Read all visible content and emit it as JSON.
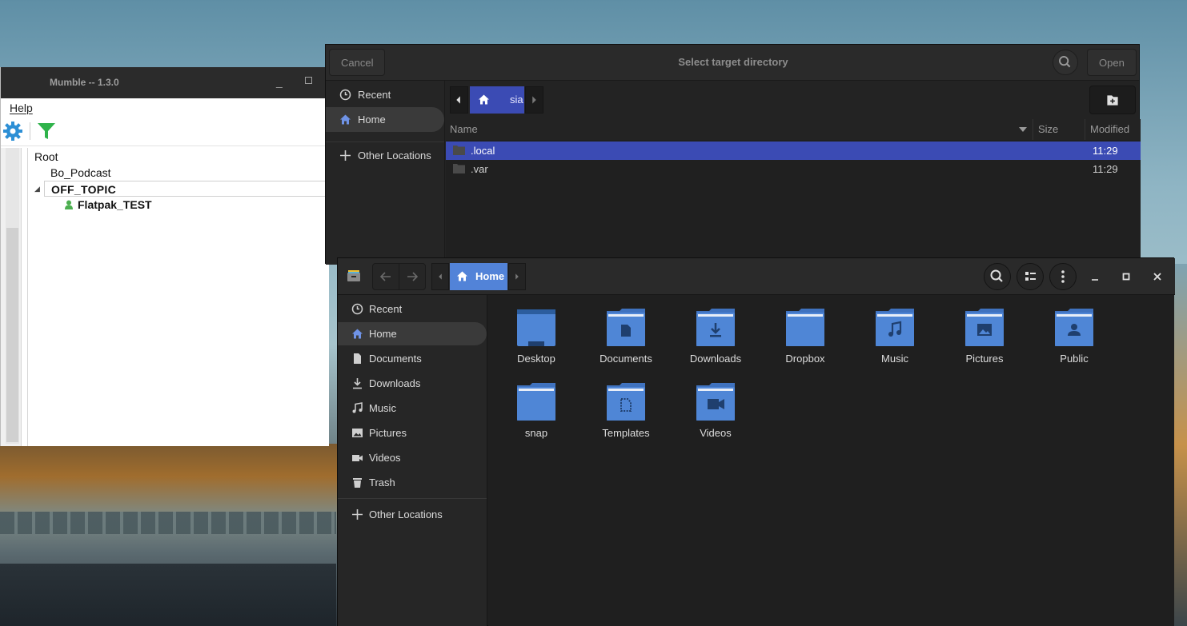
{
  "mumble": {
    "title": "Mumble -- 1.3.0",
    "menu_help": "Help",
    "tree": {
      "root": "Root",
      "channel_1": "Bo_Podcast",
      "channel_2": "OFF_TOPIC",
      "user": "Flatpak_TEST"
    }
  },
  "dialog": {
    "title": "Select target directory",
    "cancel_label": "Cancel",
    "open_label": "Open",
    "sidebar": [
      {
        "label": "Recent",
        "icon": "clock-icon"
      },
      {
        "label": "Home",
        "icon": "home-icon"
      },
      {
        "label": "Other Locations",
        "icon": "plus-icon"
      }
    ],
    "path_current": "sia",
    "columns": {
      "name": "Name",
      "size": "Size",
      "modified": "Modified"
    },
    "files": [
      {
        "name": ".local",
        "modified": "11:29"
      },
      {
        "name": ".var",
        "modified": "11:29"
      }
    ],
    "accent": "#3b4bb4"
  },
  "files": {
    "path_current": "Home",
    "sidebar": [
      {
        "label": "Recent",
        "icon": "clock-icon"
      },
      {
        "label": "Home",
        "icon": "home-icon"
      },
      {
        "label": "Documents",
        "icon": "document-icon"
      },
      {
        "label": "Downloads",
        "icon": "download-icon"
      },
      {
        "label": "Music",
        "icon": "music-icon"
      },
      {
        "label": "Pictures",
        "icon": "picture-icon"
      },
      {
        "label": "Videos",
        "icon": "video-icon"
      },
      {
        "label": "Trash",
        "icon": "trash-icon"
      },
      {
        "label": "Other Locations",
        "icon": "plus-icon"
      }
    ],
    "folders": [
      {
        "label": "Desktop",
        "icon": "desktop-folder-icon"
      },
      {
        "label": "Documents",
        "icon": "documents-folder-icon"
      },
      {
        "label": "Downloads",
        "icon": "downloads-folder-icon"
      },
      {
        "label": "Dropbox",
        "icon": "folder-icon"
      },
      {
        "label": "Music",
        "icon": "music-folder-icon"
      },
      {
        "label": "Pictures",
        "icon": "pictures-folder-icon"
      },
      {
        "label": "Public",
        "icon": "public-folder-icon"
      },
      {
        "label": "snap",
        "icon": "folder-icon"
      },
      {
        "label": "Templates",
        "icon": "templates-folder-icon"
      },
      {
        "label": "Videos",
        "icon": "videos-folder-icon"
      }
    ],
    "accent": "#5283d8",
    "folder_color": "#4f86d6"
  }
}
